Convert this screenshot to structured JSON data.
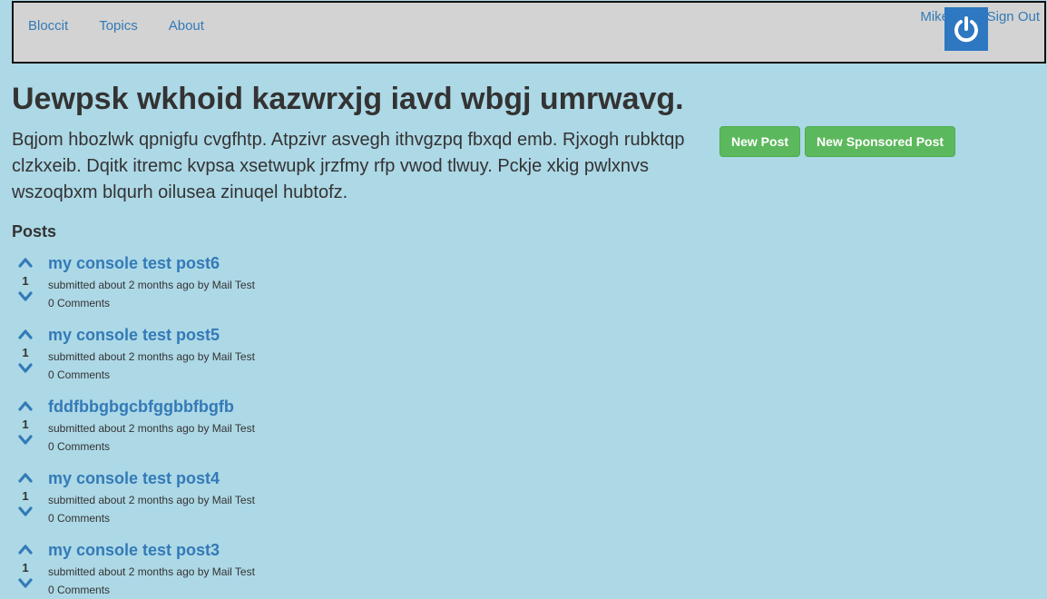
{
  "nav": {
    "brand": "Bloccit",
    "topics": "Topics",
    "about": "About",
    "user_name": "Mike",
    "sign_out": "Sign Out"
  },
  "topic": {
    "title": "Uewpsk wkhoid kazwrxjg iavd wbgj umrwavg.",
    "description": "Bqjom hbozlwk qpnigfu cvgfhtp. Atpzivr asvegh ithvgzpq fbxqd emb. Rjxogh rubktqp clzkxeib. Dqitk itremc kvpsa xsetwupk jrzfmy rfp vwod tlwuy. Pckje xkig pwlxnvs wszoqbxm blqurh oilusea zinuqel hubtofz.",
    "new_post_label": "New Post",
    "new_sponsored_post_label": "New Sponsored Post"
  },
  "posts_heading": "Posts",
  "posts": [
    {
      "title": "my console test post6",
      "votes": "1",
      "meta": "submitted about 2 months ago by Mail Test",
      "comments": "0 Comments"
    },
    {
      "title": "my console test post5",
      "votes": "1",
      "meta": "submitted about 2 months ago by Mail Test",
      "comments": "0 Comments"
    },
    {
      "title": "fddfbbgbgcbfggbbfbgfb",
      "votes": "1",
      "meta": "submitted about 2 months ago by Mail Test",
      "comments": "0 Comments"
    },
    {
      "title": "my console test post4",
      "votes": "1",
      "meta": "submitted about 2 months ago by Mail Test",
      "comments": "0 Comments"
    },
    {
      "title": "my console test post3",
      "votes": "1",
      "meta": "submitted about 2 months ago by Mail Test",
      "comments": "0 Comments"
    }
  ],
  "colors": {
    "page_background": "#add8e6",
    "navbar_background": "#d3d3d3",
    "link": "#337ab7",
    "success_button": "#5cb85c",
    "avatar_background": "#2e78c2"
  },
  "icons": {
    "avatar": "power-icon",
    "upvote": "chevron-up-icon",
    "downvote": "chevron-down-icon"
  }
}
